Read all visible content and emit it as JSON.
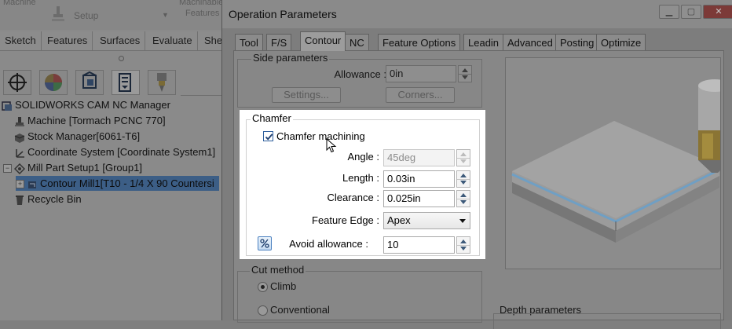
{
  "background_app": {
    "toolbar": {
      "machine_label": "Machine",
      "setup_label": "Setup",
      "machine_features_label": "Machinable",
      "features_label": "Features"
    },
    "command_tabs": [
      "Sketch",
      "Features",
      "Surfaces",
      "Evaluate",
      "She"
    ],
    "feature_manager_tabs": [
      {
        "icon": "crosshair-icon",
        "active": false
      },
      {
        "icon": "appearance-sphere-icon",
        "active": false
      },
      {
        "icon": "configuration-cube-icon",
        "active": false
      },
      {
        "icon": "cam-feature-tree-icon",
        "active": true
      },
      {
        "icon": "cam-operation-tree-icon",
        "active": false
      }
    ],
    "tree": [
      {
        "label": "SOLIDWORKS CAM NC Manager",
        "icon": "nc-manager-icon",
        "indent": 0
      },
      {
        "label": "Machine [Tormach PCNC 770]",
        "icon": "machine-icon",
        "indent": 1
      },
      {
        "label": "Stock Manager[6061-T6]",
        "icon": "stock-icon",
        "indent": 1
      },
      {
        "label": "Coordinate System [Coordinate System1]",
        "icon": "coordinate-system-icon",
        "indent": 1
      },
      {
        "label": "Mill Part Setup1 [Group1]",
        "icon": "mill-setup-icon",
        "indent": 1
      },
      {
        "label": "Contour Mill1[T10 - 1/4 X 90 Countersi",
        "icon": "contour-mill-icon",
        "indent": 2,
        "selected": true
      },
      {
        "label": "Recycle Bin",
        "icon": "recycle-bin-icon",
        "indent": 1
      }
    ]
  },
  "dialog": {
    "title": "Operation Parameters",
    "tabs": [
      {
        "label": "Tool",
        "active": false
      },
      {
        "label": "F/S",
        "active": false
      },
      {
        "label": "Contour",
        "active": true
      },
      {
        "label": "NC",
        "active": false
      },
      {
        "label": "Feature Options",
        "active": false
      },
      {
        "label": "Leadin",
        "active": false
      },
      {
        "label": "Advanced",
        "active": false
      },
      {
        "label": "Posting",
        "active": false
      },
      {
        "label": "Optimize",
        "active": false
      }
    ],
    "side_parameters": {
      "title": "Side parameters",
      "allowance_label": "Allowance :",
      "allowance_value": "0in",
      "settings_button": "Settings...",
      "corners_button": "Corners..."
    },
    "chamfer": {
      "title": "Chamfer",
      "checkbox_label": "Chamfer machining",
      "checked": true,
      "angle_label": "Angle :",
      "angle_value": "45deg",
      "length_label": "Length :",
      "length_value": "0.03in",
      "clearance_label": "Clearance :",
      "clearance_value": "0.025in",
      "feature_edge_label": "Feature Edge :",
      "feature_edge_value": "Apex",
      "avoid_allowance_label": "Avoid allowance :",
      "avoid_allowance_value": "10"
    },
    "cut_method": {
      "title": "Cut method",
      "options": [
        {
          "label": "Climb",
          "selected": true
        },
        {
          "label": "Conventional",
          "selected": false
        }
      ]
    },
    "depth_parameters_title": "Depth parameters"
  },
  "colors": {
    "highlight_bg": "#ffffff",
    "checkbox_accent": "#2e5f9d",
    "tool_holder": "#c9a227",
    "chamfer_edge": "#6f9fc4"
  }
}
